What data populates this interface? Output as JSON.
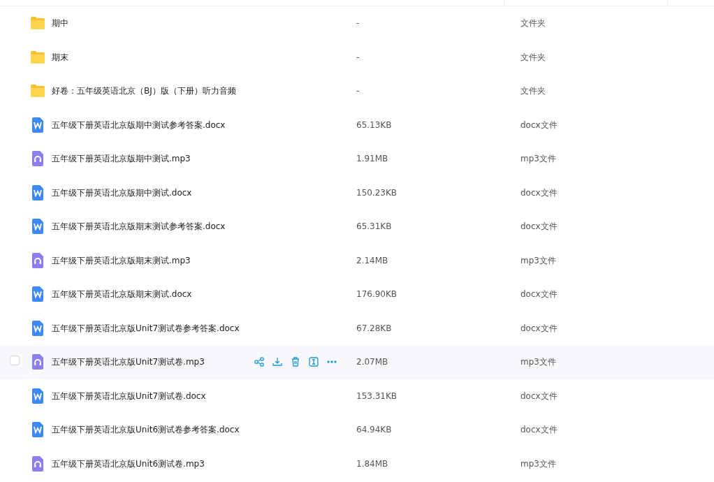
{
  "rows": [
    {
      "kind": "folder",
      "name": "期中",
      "size": "-",
      "type": "文件夹",
      "hovered": false
    },
    {
      "kind": "folder",
      "name": "期末",
      "size": "-",
      "type": "文件夹",
      "hovered": false
    },
    {
      "kind": "folder",
      "name": "好卷：五年级英语北京（BJ）版（下册）听力音频",
      "size": "-",
      "type": "文件夹",
      "hovered": false
    },
    {
      "kind": "word",
      "name": "五年级下册英语北京版期中测试参考答案.docx",
      "size": "65.13KB",
      "type": "docx文件",
      "hovered": false
    },
    {
      "kind": "audio",
      "name": "五年级下册英语北京版期中测试.mp3",
      "size": "1.91MB",
      "type": "mp3文件",
      "hovered": false
    },
    {
      "kind": "word",
      "name": "五年级下册英语北京版期中测试.docx",
      "size": "150.23KB",
      "type": "docx文件",
      "hovered": false
    },
    {
      "kind": "word",
      "name": "五年级下册英语北京版期末测试参考答案.docx",
      "size": "65.31KB",
      "type": "docx文件",
      "hovered": false
    },
    {
      "kind": "audio",
      "name": "五年级下册英语北京版期末测试.mp3",
      "size": "2.14MB",
      "type": "mp3文件",
      "hovered": false
    },
    {
      "kind": "word",
      "name": "五年级下册英语北京版期末测试.docx",
      "size": "176.90KB",
      "type": "docx文件",
      "hovered": false
    },
    {
      "kind": "word",
      "name": "五年级下册英语北京版Unit7测试卷参考答案.docx",
      "size": "67.28KB",
      "type": "docx文件",
      "hovered": false
    },
    {
      "kind": "audio",
      "name": "五年级下册英语北京版Unit7测试卷.mp3",
      "size": "2.07MB",
      "type": "mp3文件",
      "hovered": true
    },
    {
      "kind": "word",
      "name": "五年级下册英语北京版Unit7测试卷.docx",
      "size": "153.31KB",
      "type": "docx文件",
      "hovered": false
    },
    {
      "kind": "word",
      "name": "五年级下册英语北京版Unit6测试卷参考答案.docx",
      "size": "64.94KB",
      "type": "docx文件",
      "hovered": false
    },
    {
      "kind": "audio",
      "name": "五年级下册英语北京版Unit6测试卷.mp3",
      "size": "1.84MB",
      "type": "mp3文件",
      "hovered": false
    }
  ]
}
